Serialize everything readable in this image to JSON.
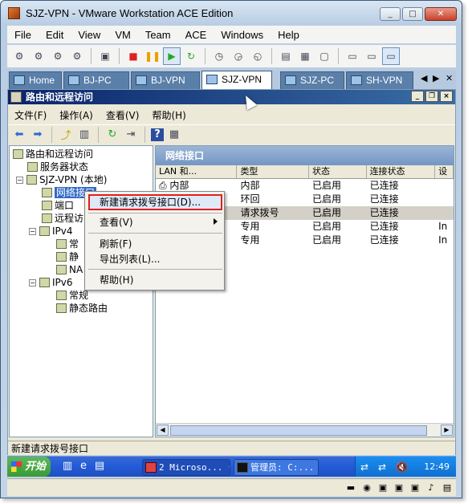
{
  "window": {
    "title": "SJZ-VPN - VMware Workstation ACE Edition",
    "caption_buttons": [
      "_",
      "□",
      "✕"
    ]
  },
  "menu": [
    "File",
    "Edit",
    "View",
    "VM",
    "Team",
    "ACE",
    "Windows",
    "Help"
  ],
  "tabs": [
    {
      "label": "Home",
      "active": false
    },
    {
      "label": "BJ-PC",
      "active": false
    },
    {
      "label": "BJ-VPN",
      "active": false
    },
    {
      "label": "SJZ-VPN",
      "active": true
    },
    {
      "label": "SJZ-PC",
      "active": false
    },
    {
      "label": "SH-VPN",
      "active": false
    }
  ],
  "tab_nav": {
    "left": "◀",
    "right": "▶",
    "close": "✕"
  },
  "rras": {
    "title": "路由和远程访问",
    "menu": [
      "文件(F)",
      "操作(A)",
      "查看(V)",
      "帮助(H)"
    ],
    "tree": {
      "root": "路由和远程访问",
      "server_status": "服务器状态",
      "server": "SJZ-VPN (本地)",
      "network_interfaces": "网络接口",
      "ports": "端口",
      "remote_access": "远程访",
      "ipv4": "IPv4",
      "ipv4_general": "常",
      "ipv4_static": "静",
      "ipv4_nat": "NA",
      "ipv6": "IPv6",
      "ipv6_general": "常规",
      "ipv6_static": "静态路由",
      "collapse_glyph": "−"
    },
    "detail": {
      "header": "网络接口",
      "columns": [
        "LAN 和...",
        "类型",
        "状态",
        "连接状态",
        "设"
      ],
      "rows": [
        [
          "内部",
          "内部",
          "已启用",
          "已连接",
          ""
        ],
        [
          "",
          "环回",
          "已启用",
          "已连接",
          ""
        ],
        [
          "",
          "请求拨号",
          "已启用",
          "已连接",
          ""
        ],
        [
          "",
          "专用",
          "已启用",
          "已连接",
          "In"
        ],
        [
          "",
          "专用",
          "已启用",
          "已连接",
          "In"
        ]
      ]
    },
    "status_text": "新建请求拨号接口",
    "context_menu": {
      "new_demand_dial": "新建请求拨号接口(D)...",
      "view": "查看(V)",
      "refresh": "刷新(F)",
      "export_list": "导出列表(L)...",
      "help": "帮助(H)"
    }
  },
  "taskbar": {
    "start": "开始",
    "buttons": [
      "2 Microso...",
      "管理员: C:..."
    ],
    "clock": "12:49"
  }
}
